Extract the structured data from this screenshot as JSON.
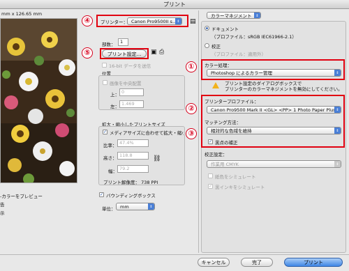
{
  "window": {
    "title": "プリント"
  },
  "preview": {
    "size_label": "mm x 126.65 mm",
    "left_labels": [
      "-カラーをプレビュー",
      "告",
      "示"
    ]
  },
  "left": {
    "printer_label": "プリンター：",
    "printer_value": "Canon Pro9500II s...",
    "copies_label": "部数：",
    "copies_value": "1",
    "print_settings_button": "プリント設定...",
    "bit16_label": "16-bit データを送信",
    "position": {
      "title": "位置",
      "center_label": "画像を中央配置",
      "top_label": "上：",
      "top_value": "0",
      "left_label": "左：",
      "left_value": "1.469"
    },
    "scaled": {
      "title": "拡大・縮小したプリントサイズ",
      "fit_label": "メディアサイズに合わせて拡大・縮小",
      "scale_label": "比率：",
      "scale_value": "47.4%",
      "height_label": "高さ：",
      "height_value": "118.8",
      "width_label": "幅：",
      "width_value": "79.2",
      "resolution": "プリント解像度： 738 PPI"
    },
    "bbox_label": "バウンディングボックス",
    "unit_label": "単位：",
    "unit_value": "mm"
  },
  "right": {
    "color_mgmt": "カラーマネジメント",
    "document_label": "ドキュメント",
    "document_profile": "（プロファイル：sRGB IEC61966-2.1）",
    "proof_label": "校正",
    "proof_profile": "（プロファイル：適用外）",
    "color_handling_label": "カラー処理：",
    "color_handling_value": "Photoshop によるカラー管理",
    "warning_text": "プリント設定のダイアログボックスで\nプリンターのカラーマネジメントを無効にしてください。",
    "printer_profile_label": "プリンタープロファイル：",
    "printer_profile_value": "Canon Pro9500 Mark II <GL> <PP> 1 Photo Paper Plus ...",
    "matching_label": "マッチング方法：",
    "matching_value": "相対的な色域を維持",
    "bpc_label": "黒点の補正",
    "proof_setup_label": "校正設定：",
    "proof_setup_value": "作業用 CMYK",
    "simulate_paper": "紙色をシミュレート",
    "simulate_ink": "黒インキをシミュレート"
  },
  "footer": {
    "cancel": "キャンセル",
    "done": "完了",
    "print": "プリント"
  },
  "markers": [
    "①",
    "②",
    "③",
    "④",
    "⑤"
  ]
}
